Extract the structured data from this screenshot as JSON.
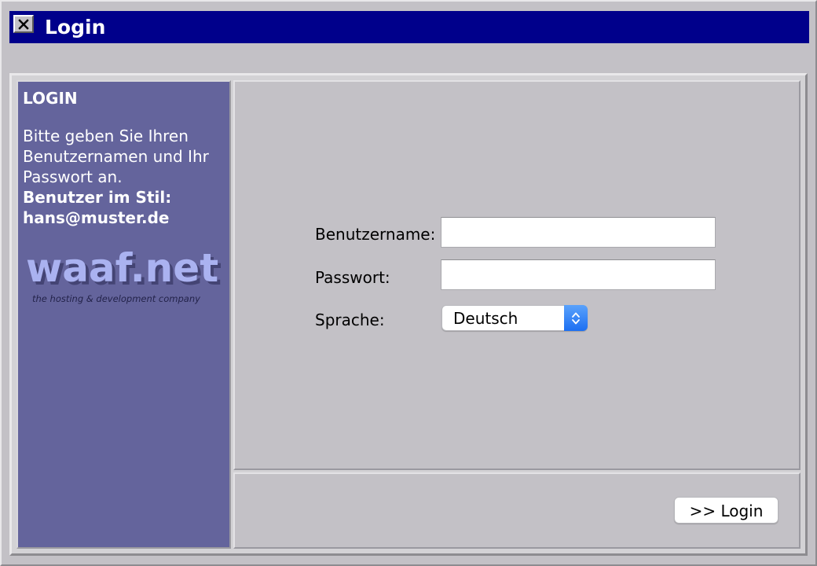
{
  "window": {
    "title": "Login"
  },
  "sidebar": {
    "heading": "LOGIN",
    "instruction_lines": [
      "Bitte geben Sie Ihren",
      "Benutzernamen und Ihr",
      "Passwort an."
    ],
    "format_lines": [
      "Benutzer im Stil:",
      "hans@muster.de"
    ],
    "logo": {
      "text": "waaf.net",
      "tagline": "the hosting & development company"
    }
  },
  "form": {
    "username_label": "Benutzername:",
    "username_value": "",
    "password_label": "Passwort:",
    "password_value": "",
    "language_label": "Sprache:",
    "language_selected": "Deutsch"
  },
  "footer": {
    "login_button": ">> Login"
  },
  "colors": {
    "titlebar": "#00008b",
    "sidebar": "#64649c",
    "panel": "#c3c1c6",
    "select_accent": "#1c6ff2"
  },
  "icons": {
    "close": "close-icon",
    "select_arrows": "chevron-updown-icon"
  }
}
